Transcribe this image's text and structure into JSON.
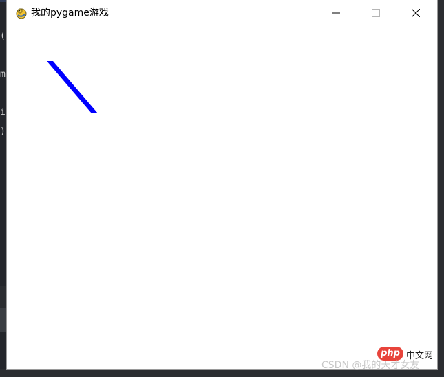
{
  "window": {
    "title": "我的pygame游戏",
    "icon": "pygame-snake-icon"
  },
  "titlebar_buttons": {
    "minimize": "minimize-icon",
    "maximize": "maximize-icon",
    "close": "close-icon"
  },
  "canvas": {
    "background": "#ffffff",
    "line_color": "#0000ff"
  },
  "background_editor": {
    "gutter_chars": [
      "(",
      "m",
      "i",
      ")"
    ]
  },
  "watermarks": {
    "php_logo": "php",
    "php_site": "中文网",
    "csdn": "CSDN @我的天才女友"
  }
}
